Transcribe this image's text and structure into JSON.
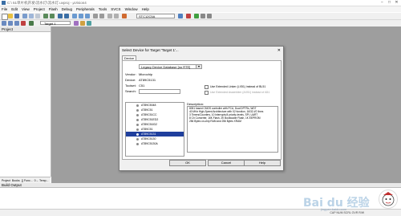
{
  "window": {
    "title": "C:\\ 51单片机开发\\流水灯\\流水灯.uvproj - µVision4",
    "controls": {
      "minimize": "−",
      "maximize": "□",
      "close": "✕"
    }
  },
  "menu": [
    "File",
    "Edit",
    "View",
    "Project",
    "Flash",
    "Debug",
    "Peripherals",
    "Tools",
    "SVCS",
    "Window",
    "Help"
  ],
  "toolbar": {
    "device_combo_value": "STC12C5A",
    "target_combo_value": "Target 1"
  },
  "project_panel": {
    "title": "Project",
    "tabs": [
      "Project",
      "Books",
      "{} Func...",
      "0→ Temp..."
    ]
  },
  "build_output": {
    "title": "Build Output"
  },
  "statusbar": {
    "caps": "CAP NUM SCRL OVR R/W"
  },
  "dialog": {
    "title": "Select Device for Target 'Target 1'...",
    "close": "✕",
    "tab": "Device",
    "database": "Legacy Device Database [no RTE]",
    "fields": {
      "vendor_label": "Vendor:",
      "vendor": "Microchip",
      "device_label": "Device:",
      "device": "AT89C5131",
      "toolset_label": "Toolset:",
      "toolset": "C51",
      "search_label": "Search:"
    },
    "options": [
      {
        "label": "Use Extended Linker (LX51) instead of BL51",
        "enabled": true
      },
      {
        "label": "Use Extended Assembler (AX51) instead of A51",
        "enabled": false
      }
    ],
    "description_label": "Description:",
    "description": [
      "8051 based CMOS controller with PCA, Dual DPTRs, WDT",
      "40 MHz High-Speed Architecture with X2 function, 16/32-I/O lines",
      "3 Timers/Counters, 10 Interrupts/4 priority levels, SPI, UART",
      "8 Ch Converter, 16K Flash, 2K Bootloader Flash, 1K EEPROM",
      "256 Bytes on-chip RAM and 256 Bytes XRAM"
    ],
    "devices": [
      "AT89C5048",
      "AT89C51",
      "AT89C51CC",
      "AT89C51ED2",
      "AT89C51ID2",
      "AT89C51",
      "AT89C5131",
      "AT89C5130",
      "AT89C5130A"
    ],
    "selected_index": 6,
    "buttons": {
      "ok": "OK",
      "cancel": "Cancel",
      "help": "Help"
    }
  },
  "watermark": {
    "logo": "Bai du 经验",
    "sub": "jingyan.baidu.com"
  }
}
